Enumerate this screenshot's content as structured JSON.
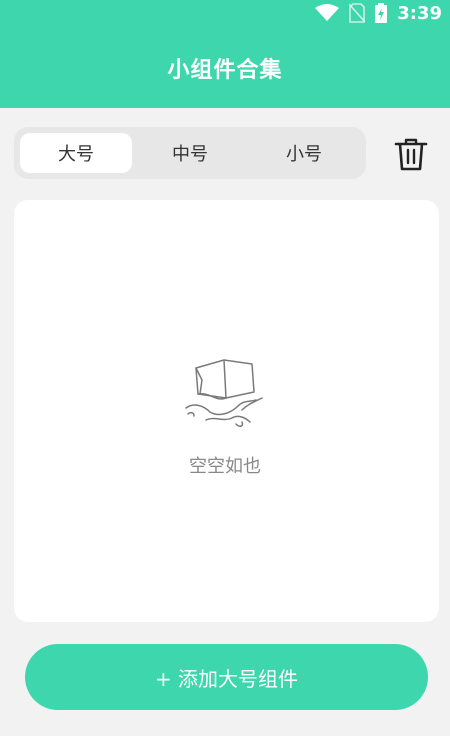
{
  "status_bar": {
    "time": "3:39",
    "icons": [
      "wifi-icon",
      "no-sim-icon",
      "battery-charging-icon"
    ]
  },
  "header": {
    "title": "小组件合集"
  },
  "size_tabs": {
    "items": [
      {
        "label": "大号",
        "selected": true
      },
      {
        "label": "中号",
        "selected": false
      },
      {
        "label": "小号",
        "selected": false
      }
    ]
  },
  "toolbar": {
    "delete_icon": "trash-icon"
  },
  "empty_state": {
    "icon": "empty-box-icon",
    "text": "空空如也"
  },
  "footer": {
    "add_button_label": "+ 添加大号组件"
  },
  "colors": {
    "accent": "#3dd6ad",
    "background": "#f2f2f2",
    "card": "#ffffff",
    "tab_track": "#e7e7e7"
  }
}
